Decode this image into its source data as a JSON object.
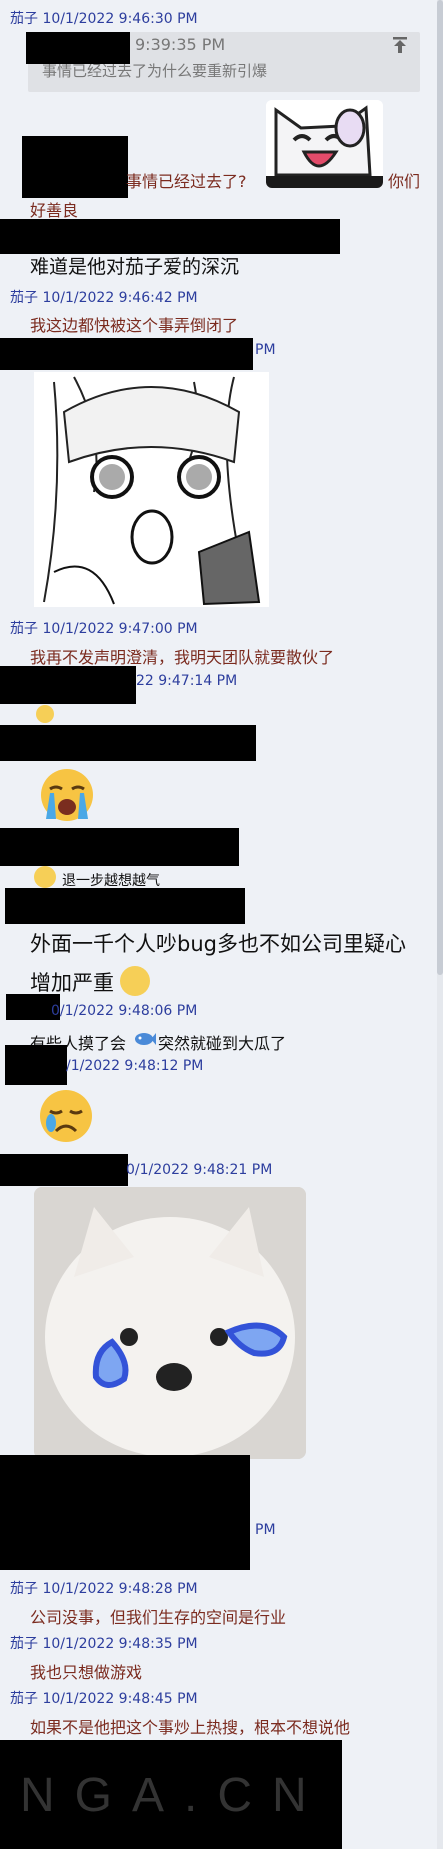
{
  "messages": [
    {
      "header": "茄子 10/1/2022 9:46:30 PM"
    },
    {
      "quote_time": "9:39:35 PM",
      "quote_text": "事情已经过去了为什么要重新引爆"
    },
    {
      "text": "事情已经过去了?",
      "suffix": "你们",
      "line2": "好善良"
    },
    {
      "text": "难道是他对茄子爱的深沉"
    },
    {
      "header": "茄子 10/1/2022 9:46:42 PM",
      "text": "我这边都快被这个事弄倒闭了"
    },
    {
      "header_tail": "PM"
    },
    {
      "header": "茄子 10/1/2022 9:47:00 PM",
      "text": "我再不发声明澄清，我明天团队就要散伙了"
    },
    {
      "header_tail": "22 9:47:14 PM"
    },
    {
      "text": "退一步越想越气"
    },
    {
      "text_line1": "外面一千个人吵bug多也不如公司里疑心",
      "text_line2": "增加严重"
    },
    {
      "header_tail": "0/1/2022 9:48:06 PM",
      "text_pre": "有些人摸了会",
      "text_post": "突然就碰到大瓜了"
    },
    {
      "header_tail": "/1/2022 9:48:12 PM"
    },
    {
      "header_tail": "0/1/2022 9:48:21 PM"
    },
    {
      "header_tail": "PM"
    },
    {
      "header": "茄子 10/1/2022 9:48:28 PM",
      "text": "公司没事，但我们生存的空间是行业"
    },
    {
      "header": "茄子 10/1/2022 9:48:35 PM",
      "text": "我也只想做游戏"
    },
    {
      "header": "茄子 10/1/2022 9:48:45 PM",
      "text": "如果不是他把这个事炒上热搜，根本不想说他"
    }
  ],
  "watermark": "NGA.CN",
  "colors": {
    "header": "#2d3e9e",
    "message": "#7b2b1f",
    "background": "#eef1f6"
  },
  "icons": [
    "jump-to-quote-icon",
    "blush-emoji-icon",
    "crying-emoji-icon",
    "smirk-emoji-icon",
    "sweat-emoji-icon",
    "fish-emoji-icon",
    "sad-emoji-icon"
  ]
}
